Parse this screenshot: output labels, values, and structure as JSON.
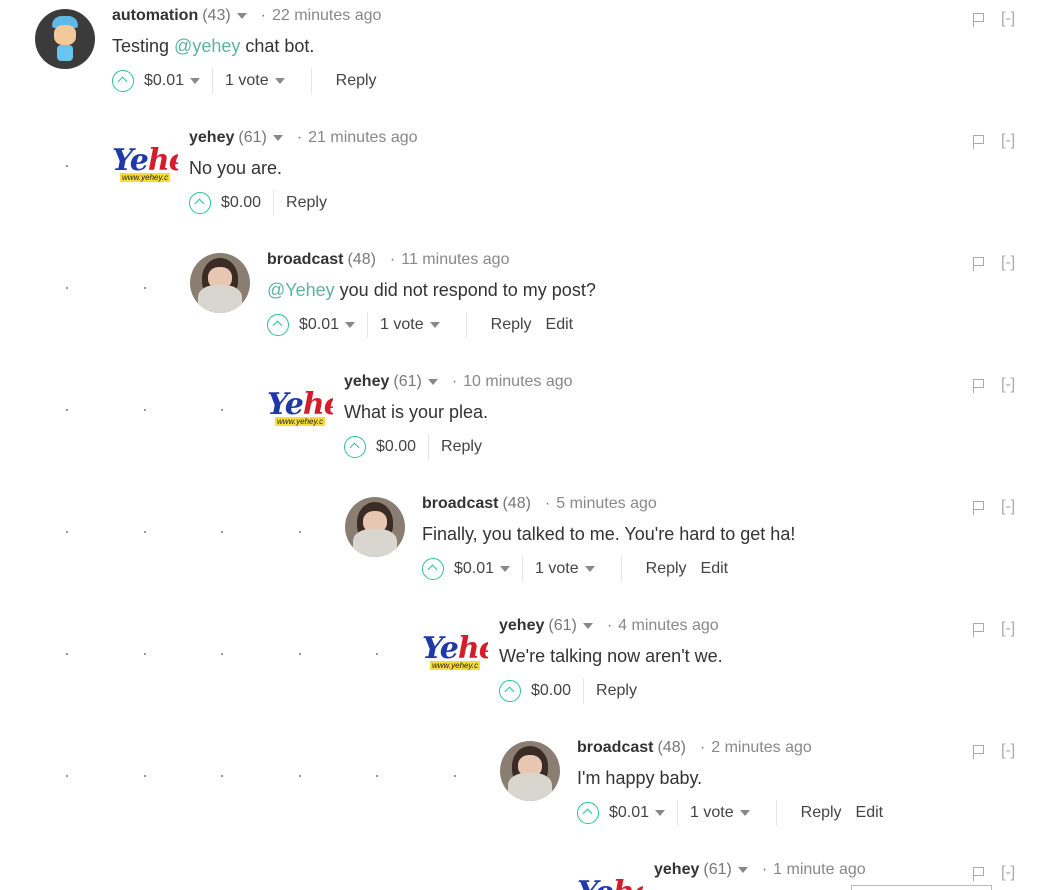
{
  "comments": [
    {
      "author": "automation",
      "reputation": "(43)",
      "time": "22 minutes ago",
      "text_before": "Testing ",
      "mention": "@yehey",
      "text_after": " chat bot.",
      "payout": "$0.01",
      "votes": "1 vote",
      "reply": "Reply",
      "edit": "",
      "avatar": "robot-avatar"
    },
    {
      "author": "yehey",
      "reputation": "(61)",
      "time": "21 minutes ago",
      "text_before": "No you are.",
      "mention": "",
      "text_after": "",
      "payout": "$0.00",
      "votes": "",
      "reply": "Reply",
      "edit": "",
      "avatar": "yehey-logo"
    },
    {
      "author": "broadcast",
      "reputation": "(48)",
      "time": "11 minutes ago",
      "text_before": "",
      "mention": "@Yehey",
      "text_after": " you did not respond to my post?",
      "payout": "$0.01",
      "votes": "1 vote",
      "reply": "Reply",
      "edit": "Edit",
      "avatar": "woman-avatar"
    },
    {
      "author": "yehey",
      "reputation": "(61)",
      "time": "10 minutes ago",
      "text_before": "What is your plea.",
      "mention": "",
      "text_after": "",
      "payout": "$0.00",
      "votes": "",
      "reply": "Reply",
      "edit": "",
      "avatar": "yehey-logo"
    },
    {
      "author": "broadcast",
      "reputation": "(48)",
      "time": "5 minutes ago",
      "text_before": "Finally, you talked to me. You're hard to get ha!",
      "mention": "",
      "text_after": "",
      "payout": "$0.01",
      "votes": "1 vote",
      "reply": "Reply",
      "edit": "Edit",
      "avatar": "woman-avatar"
    },
    {
      "author": "yehey",
      "reputation": "(61)",
      "time": "4 minutes ago",
      "text_before": "We're talking now aren't we.",
      "mention": "",
      "text_after": "",
      "payout": "$0.00",
      "votes": "",
      "reply": "Reply",
      "edit": "",
      "avatar": "yehey-logo"
    },
    {
      "author": "broadcast",
      "reputation": "(48)",
      "time": "2 minutes ago",
      "text_before": "I'm happy baby.",
      "mention": "",
      "text_after": "",
      "payout": "$0.01",
      "votes": "1 vote",
      "reply": "Reply",
      "edit": "Edit",
      "avatar": "woman-avatar"
    },
    {
      "author": "yehey",
      "reputation": "(61)",
      "time": "1 minute ago",
      "text_before": "",
      "mention": "",
      "text_after": "",
      "payout": "",
      "votes": "",
      "reply": "",
      "edit": "",
      "avatar": "yehey-logo"
    }
  ],
  "ui": {
    "separator": "·",
    "collapse_label": "[-]",
    "logo_text_a": "Ye",
    "logo_text_b": "hey",
    "logo_sub": "www.yehey.c",
    "accent_color": "#27c494",
    "mention_color": "#5fb2a0"
  }
}
